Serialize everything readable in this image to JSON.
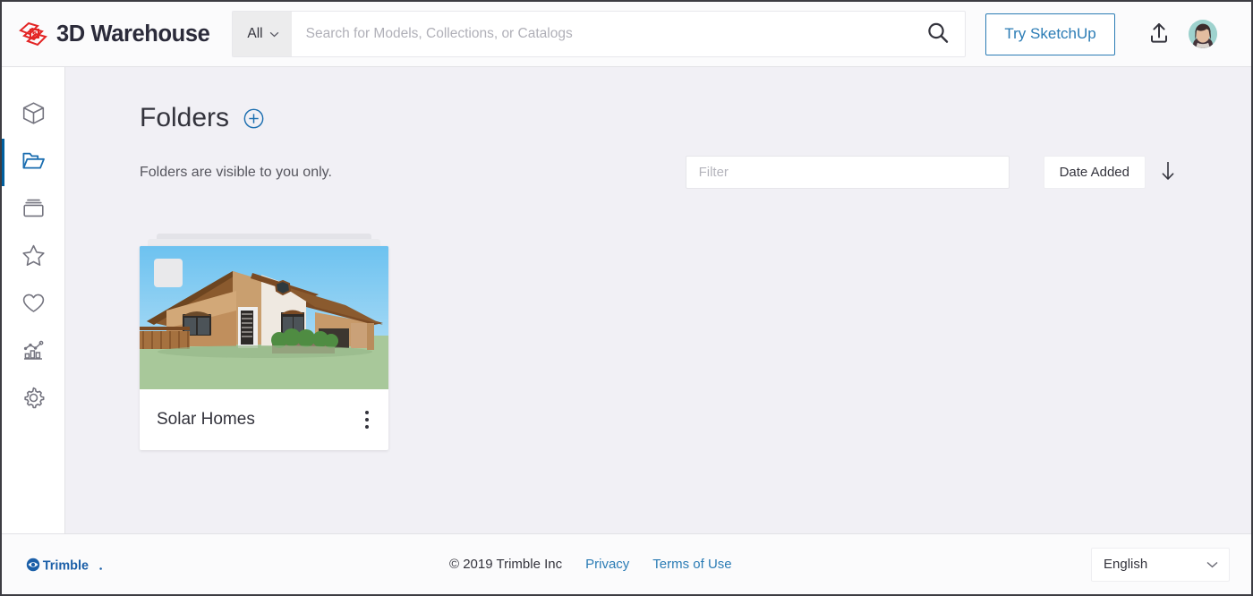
{
  "header": {
    "brand_name": "3D Warehouse",
    "brand_logo_icon": "3d-warehouse-logo",
    "search_scope_label": "All",
    "search_scope_chevron_icon": "chevron-down-icon",
    "search_placeholder": "Search for Models, Collections, or Catalogs",
    "search_value": "",
    "search_icon": "search-icon",
    "try_sketchup_label": "Try SketchUp",
    "upload_icon": "upload-icon",
    "avatar_icon": "user-avatar"
  },
  "sidebar": {
    "items": [
      {
        "name": "models",
        "icon": "cube-icon",
        "active": false
      },
      {
        "name": "folders",
        "icon": "folder-open-icon",
        "active": true
      },
      {
        "name": "collections",
        "icon": "collections-stack-icon",
        "active": false
      },
      {
        "name": "favorites",
        "icon": "star-icon",
        "active": false
      },
      {
        "name": "likes",
        "icon": "heart-icon",
        "active": false
      },
      {
        "name": "analytics",
        "icon": "analytics-chart-icon",
        "active": false
      },
      {
        "name": "settings",
        "icon": "gear-icon",
        "active": false
      }
    ]
  },
  "main": {
    "title": "Folders",
    "add_folder_icon": "plus-circle-icon",
    "subtitle": "Folders are visible to you only.",
    "filter_placeholder": "Filter",
    "filter_value": "",
    "sort_label": "Date Added",
    "sort_direction_icon": "arrow-down-icon",
    "cards": [
      {
        "title": "Solar Homes",
        "thumbnail": "house-render-thumbnail",
        "menu_icon": "kebab-menu-icon"
      }
    ]
  },
  "footer": {
    "trimble_logo": "trimble-logo",
    "copyright": "© 2019 Trimble Inc",
    "links": [
      {
        "label": "Privacy"
      },
      {
        "label": "Terms of Use"
      }
    ],
    "language": "English",
    "language_chevron_icon": "chevron-down-icon"
  },
  "colors": {
    "accent_blue": "#2b7cb5",
    "active_blue": "#005f9e",
    "logo_red": "#e32525",
    "page_bg": "#f1f0f5",
    "text_dark": "#33333c"
  }
}
